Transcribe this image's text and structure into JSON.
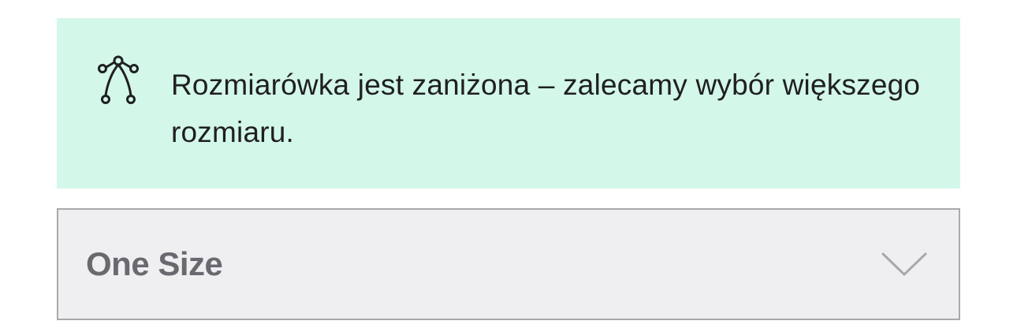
{
  "notice": {
    "icon": "curve-anchor-icon",
    "text": "Rozmiarówka jest zaniżona – zalecamy wybór większego rozmiaru.",
    "background": "#d3f7e8"
  },
  "size_select": {
    "selected_value": "One Size",
    "icon": "chevron-down-icon"
  }
}
